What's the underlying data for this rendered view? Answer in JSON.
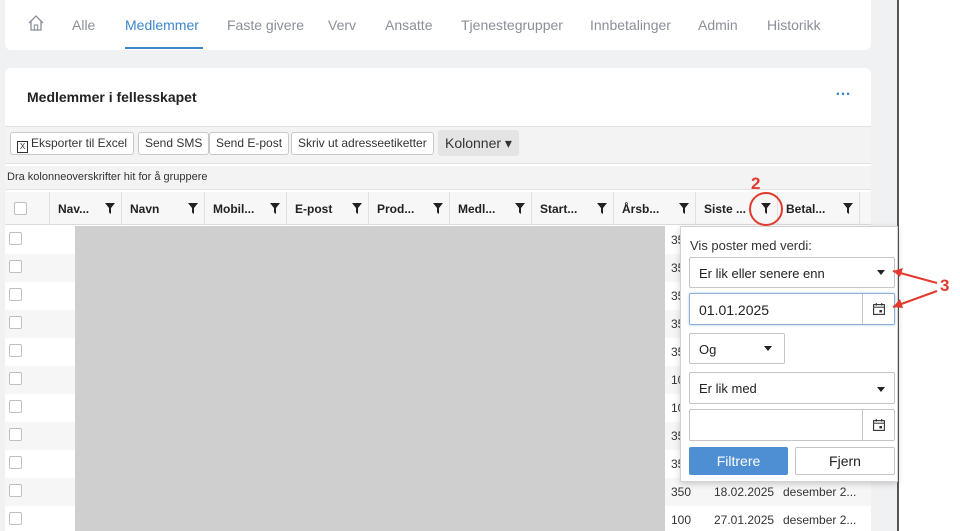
{
  "nav": {
    "tabs": [
      {
        "label": "Alle",
        "active": false
      },
      {
        "label": "Medlemmer",
        "active": true
      },
      {
        "label": "Faste givere",
        "active": false
      },
      {
        "label": "Verv",
        "active": false
      },
      {
        "label": "Ansatte",
        "active": false
      },
      {
        "label": "Tjenestegrupper",
        "active": false
      },
      {
        "label": "Innbetalinger",
        "active": false
      },
      {
        "label": "Admin",
        "active": false
      },
      {
        "label": "Historikk",
        "active": false
      }
    ]
  },
  "card": {
    "title": "Medlemmer i fellesskapet",
    "more": "…"
  },
  "toolbar": {
    "export_excel": "Eksporter til Excel",
    "send_sms": "Send SMS",
    "send_email": "Send E-post",
    "print_labels": "Skriv ut adresseetiketter",
    "columns": "Kolonner ▾"
  },
  "groupbar": {
    "hint": "Dra kolonneoverskrifter hit for å gruppere"
  },
  "columns": [
    {
      "label": "Nav..."
    },
    {
      "label": "Navn"
    },
    {
      "label": "Mobil..."
    },
    {
      "label": "E-post"
    },
    {
      "label": "Prod..."
    },
    {
      "label": "Medl..."
    },
    {
      "label": "Start..."
    },
    {
      "label": "Årsb..."
    },
    {
      "label": "Siste ..."
    },
    {
      "label": "Betal..."
    }
  ],
  "rows": [
    {
      "amount": "35"
    },
    {
      "amount": "35"
    },
    {
      "amount": "35"
    },
    {
      "amount": "35"
    },
    {
      "amount": "35"
    },
    {
      "amount": "10"
    },
    {
      "amount": "10"
    },
    {
      "amount": "35"
    },
    {
      "amount": "35"
    },
    {
      "amount": "350",
      "last_date": "18.02.2025",
      "payment": "desember 2..."
    },
    {
      "amount": "100",
      "last_date": "27.01.2025",
      "payment": "desember 2..."
    }
  ],
  "filter_popup": {
    "title": "Vis poster med verdi:",
    "operator1": "Er lik eller senere enn",
    "value1": "01.01.2025",
    "logic": "Og",
    "operator2": "Er lik med",
    "value2": "",
    "filter_button": "Filtrere",
    "remove_button": "Fjern"
  },
  "annotations": {
    "label2": "2",
    "label3": "3",
    "color": "#e33a2f"
  }
}
